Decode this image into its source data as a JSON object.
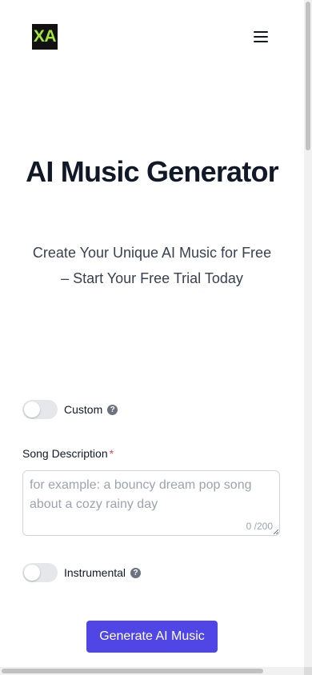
{
  "header": {
    "logo_text": "XA",
    "logo_colors": {
      "background": "#111111",
      "text": "#a3e635"
    },
    "menu_icon": "hamburger-menu-icon"
  },
  "hero": {
    "title": "AI Music Generator",
    "subtitle": "Create Your Unique AI Music for Free – Start Your Free Trial Today"
  },
  "form": {
    "custom_toggle": {
      "label": "Custom",
      "checked": false,
      "help_icon": "question-circle-icon"
    },
    "song_description": {
      "label": "Song Description",
      "required_mark": "*",
      "value": "",
      "placeholder": "for example: a bouncy dream pop song about a cozy rainy day",
      "counter": "0 /200"
    },
    "instrumental_toggle": {
      "label": "Instrumental",
      "checked": false,
      "help_icon": "question-circle-icon"
    },
    "generate_label": "Generate AI Music"
  },
  "colors": {
    "accent": "#4f46e5",
    "required": "#ef4444",
    "toggle_off": "#e5e7eb"
  }
}
